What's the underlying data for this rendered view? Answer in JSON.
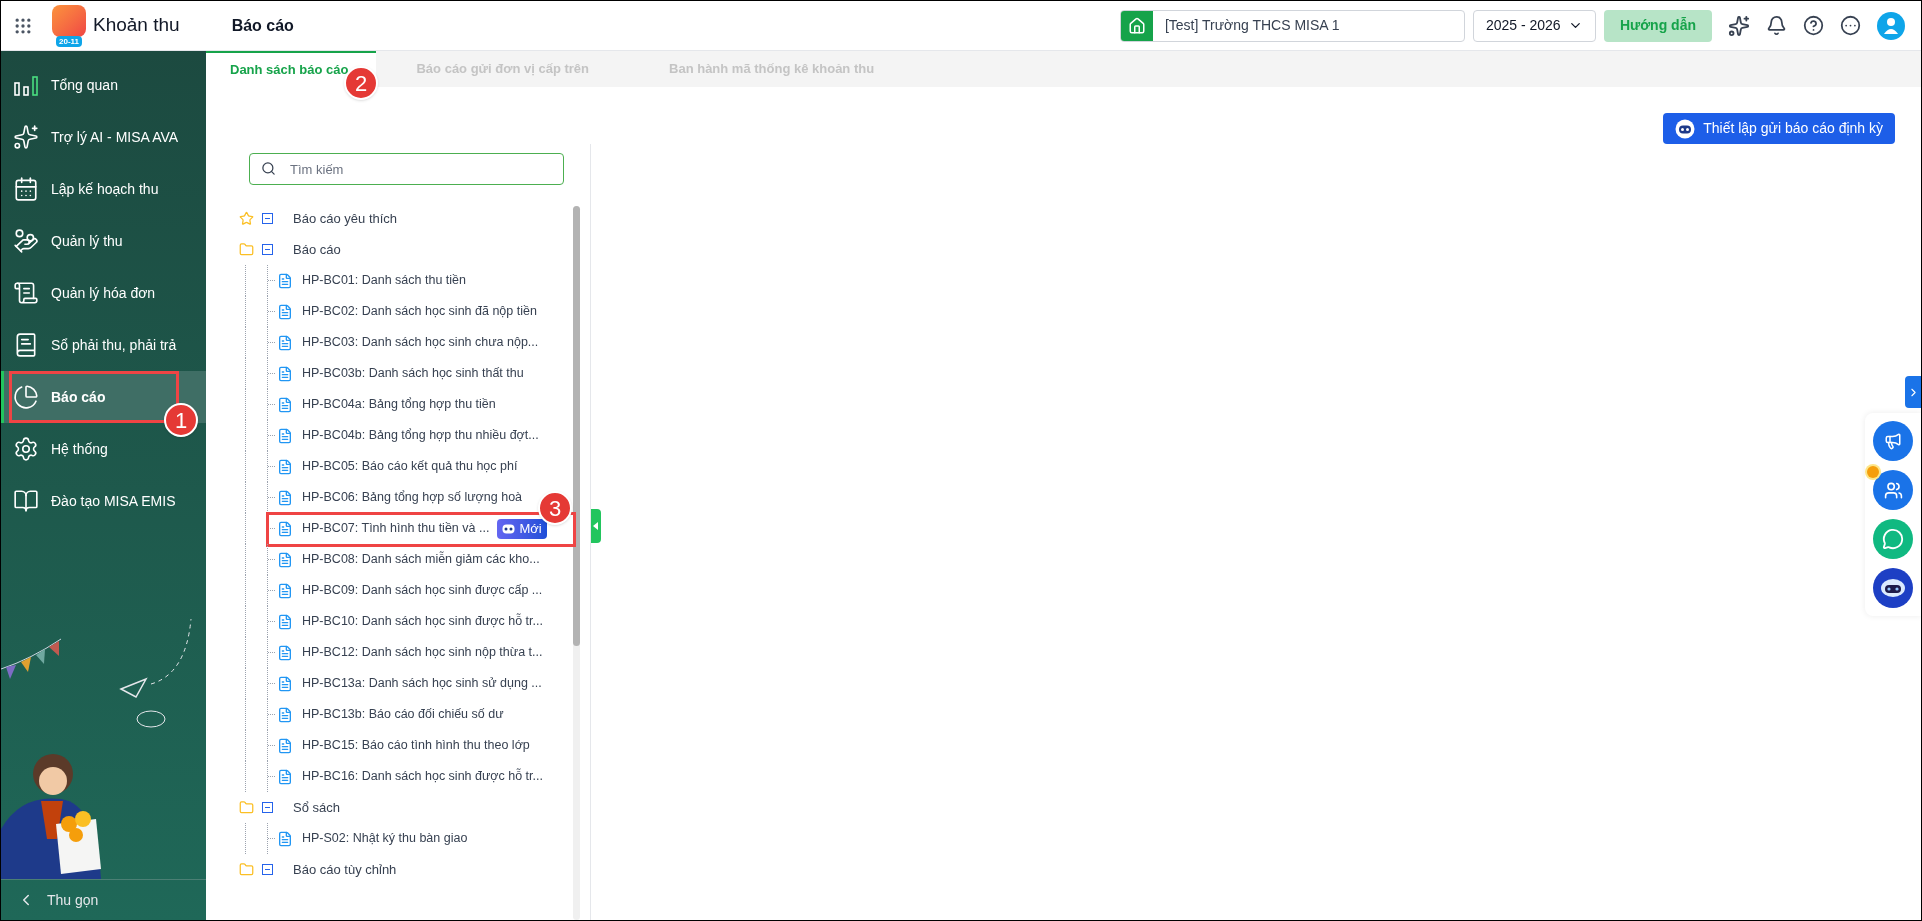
{
  "header": {
    "app_name": "Khoản thu",
    "logo_badge": "20-11",
    "page_title": "Báo cáo",
    "school": "[Test] Trường THCS MISA 1",
    "year": "2025 - 2026",
    "guide_button": "Hướng dẫn"
  },
  "sidebar": {
    "items": [
      {
        "label": "Tổng quan",
        "selected": false,
        "highlighted": false
      },
      {
        "label": "Trợ lý AI - MISA AVA",
        "selected": false,
        "highlighted": false
      },
      {
        "label": "Lập kế hoạch thu",
        "selected": false,
        "highlighted": false
      },
      {
        "label": "Quản lý thu",
        "selected": false,
        "highlighted": false
      },
      {
        "label": "Quản lý hóa đơn",
        "selected": false,
        "highlighted": false
      },
      {
        "label": "Sổ phải thu, phải trả",
        "selected": false,
        "highlighted": false
      },
      {
        "label": "Báo cáo",
        "selected": true,
        "highlighted": true,
        "callout": "1"
      },
      {
        "label": "Hệ thống",
        "selected": false,
        "highlighted": false
      },
      {
        "label": "Đào tạo MISA EMIS",
        "selected": false,
        "highlighted": false
      }
    ],
    "collapse": "Thu gọn"
  },
  "tabs": [
    {
      "label": "Danh sách báo cáo",
      "selected": true,
      "callout": "2"
    },
    {
      "label": "Báo cáo gửi đơn vị cấp trên",
      "selected": false
    },
    {
      "label": "Ban hành mã thống kê khoản thu",
      "selected": false
    }
  ],
  "schedule_button": "Thiết lập gửi báo cáo định kỳ",
  "search": {
    "placeholder": "Tìm kiếm"
  },
  "tree": [
    {
      "kind": "favorites",
      "label": "Báo cáo yêu thích",
      "expanded": true
    },
    {
      "kind": "folder",
      "label": "Báo cáo",
      "expanded": true,
      "children": [
        {
          "label": "HP-BC01: Danh sách thu tiền",
          "highlighted": false
        },
        {
          "label": "HP-BC02: Danh sách học sinh đã nộp tiền",
          "highlighted": false
        },
        {
          "label": "HP-BC03: Danh sách học sinh chưa nộp...",
          "highlighted": false
        },
        {
          "label": "HP-BC03b: Danh sách học sinh thất thu",
          "highlighted": false
        },
        {
          "label": "HP-BC04a: Bảng tổng hợp thu tiền",
          "highlighted": false
        },
        {
          "label": "HP-BC04b: Bảng tổng hợp thu nhiều đợt...",
          "highlighted": false
        },
        {
          "label": "HP-BC05: Báo cáo kết quả thu học phí",
          "highlighted": false
        },
        {
          "label": "HP-BC06: Bảng tổng hợp số lượng hoà",
          "highlighted": false
        },
        {
          "label": "HP-BC07: Tình hình thu tiền và ...",
          "highlighted": true,
          "badge": "Mới",
          "callout": "3"
        },
        {
          "label": "HP-BC08: Danh sách miễn giảm các kho...",
          "highlighted": false
        },
        {
          "label": "HP-BC09: Danh sách học sinh được cấp ...",
          "highlighted": false
        },
        {
          "label": "HP-BC10: Danh sách học sinh được hỗ tr...",
          "highlighted": false
        },
        {
          "label": "HP-BC12: Danh sách học sinh nộp thừa t...",
          "highlighted": false
        },
        {
          "label": "HP-BC13a: Danh sách học sinh sử dụng ...",
          "highlighted": false
        },
        {
          "label": "HP-BC13b: Báo cáo đối chiếu số dư",
          "highlighted": false
        },
        {
          "label": "HP-BC15: Báo cáo tình hình thu theo lớp",
          "highlighted": false
        },
        {
          "label": "HP-BC16: Danh sách học sinh được hỗ tr...",
          "highlighted": false
        }
      ]
    },
    {
      "kind": "folder",
      "label": "Sổ sách",
      "expanded": true,
      "children": [
        {
          "label": "HP-S02: Nhật ký thu bàn giao",
          "highlighted": false
        }
      ]
    },
    {
      "kind": "folder",
      "label": "Báo cáo tùy chỉnh",
      "expanded": true
    }
  ]
}
